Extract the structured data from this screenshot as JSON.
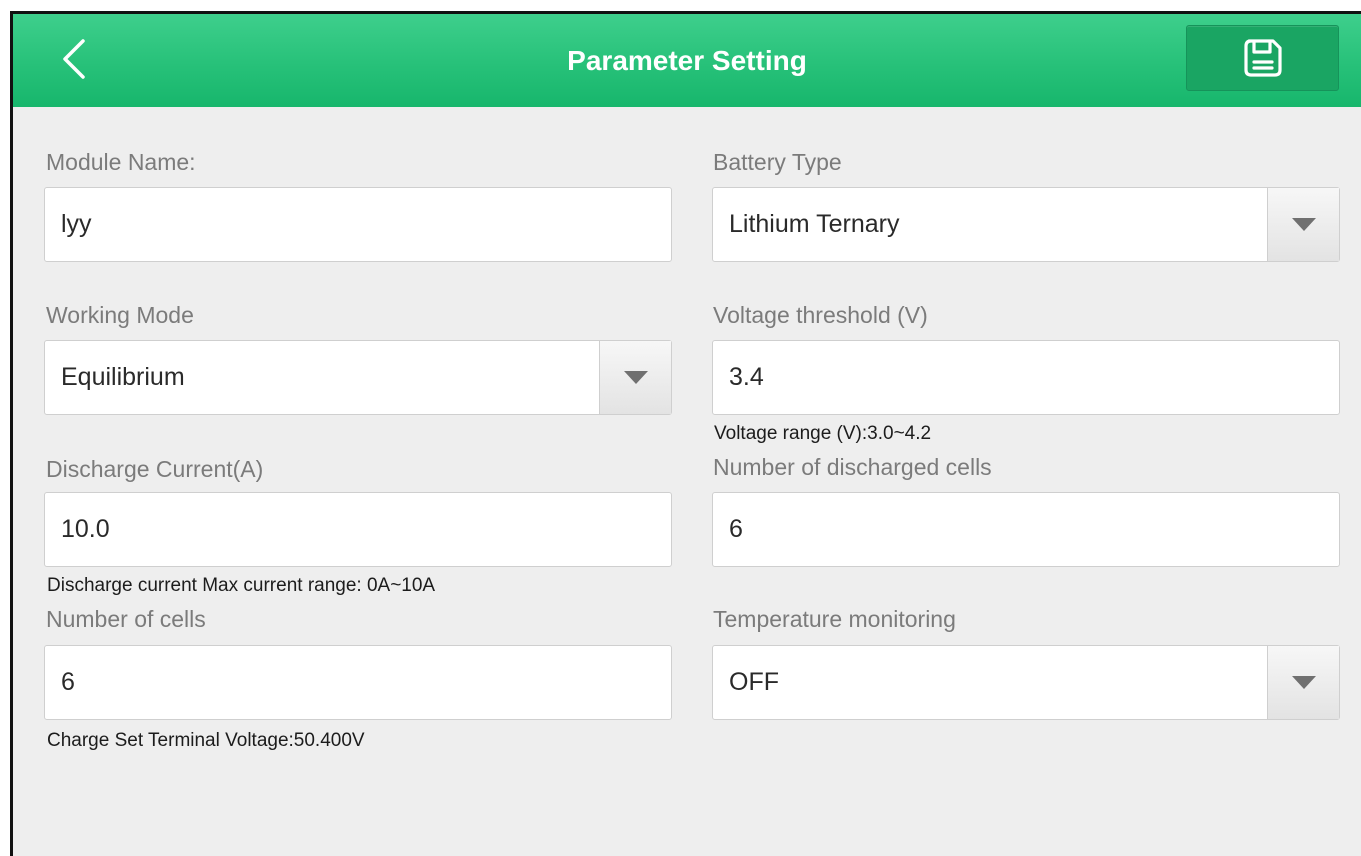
{
  "header": {
    "title": "Parameter Setting",
    "back_icon": "chevron-left-icon",
    "save_icon": "save-icon",
    "accent_color": "#22bf75"
  },
  "form": {
    "module_name": {
      "label": "Module Name:",
      "value": "lyy"
    },
    "battery_type": {
      "label": "Battery Type",
      "value": "Lithium Ternary"
    },
    "working_mode": {
      "label": "Working Mode",
      "value": "Equilibrium"
    },
    "voltage_threshold": {
      "label": "Voltage threshold (V)",
      "value": "3.4",
      "note": "Voltage range (V):3.0~4.2"
    },
    "discharge_current": {
      "label": "Discharge Current(A)",
      "value": "10.0",
      "note": "Discharge current Max current range: 0A~10A"
    },
    "discharged_cells": {
      "label": "Number of discharged cells",
      "value": "6"
    },
    "number_of_cells": {
      "label": "Number of cells",
      "value": "6",
      "note": "Charge Set Terminal Voltage:50.400V"
    },
    "temperature_monitoring": {
      "label": "Temperature monitoring",
      "value": "OFF"
    }
  }
}
